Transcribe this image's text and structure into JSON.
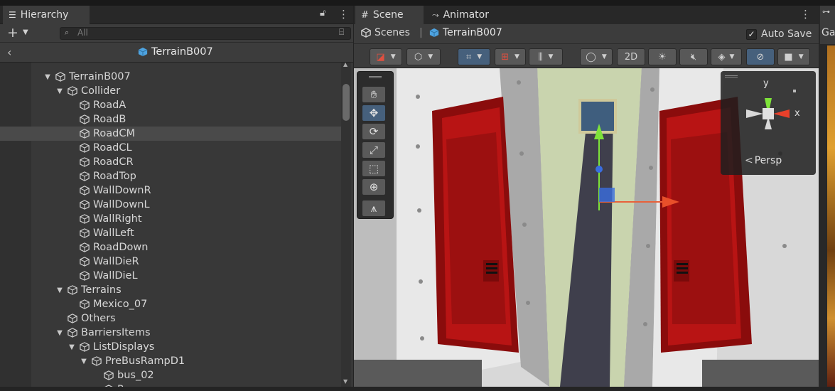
{
  "hierarchy": {
    "tab_label": "Hierarchy",
    "search_placeholder": "All",
    "breadcrumb": "TerrainB007",
    "items": [
      {
        "label": "TerrainB007",
        "depth": 0,
        "expanded": true
      },
      {
        "label": "Collider",
        "depth": 1,
        "expanded": true
      },
      {
        "label": "RoadA",
        "depth": 2
      },
      {
        "label": "RoadB",
        "depth": 2
      },
      {
        "label": "RoadCM",
        "depth": 2,
        "selected": true
      },
      {
        "label": "RoadCL",
        "depth": 2
      },
      {
        "label": "RoadCR",
        "depth": 2
      },
      {
        "label": "RoadTop",
        "depth": 2
      },
      {
        "label": "WallDownR",
        "depth": 2
      },
      {
        "label": "WallDownL",
        "depth": 2
      },
      {
        "label": "WallRight",
        "depth": 2
      },
      {
        "label": "WallLeft",
        "depth": 2
      },
      {
        "label": "RoadDown",
        "depth": 2
      },
      {
        "label": "WallDieR",
        "depth": 2
      },
      {
        "label": "WallDieL",
        "depth": 2
      },
      {
        "label": "Terrains",
        "depth": 1,
        "expanded": true
      },
      {
        "label": "Mexico_07",
        "depth": 2
      },
      {
        "label": "Others",
        "depth": 1
      },
      {
        "label": "BarriersItems",
        "depth": 1,
        "expanded": true
      },
      {
        "label": "ListDisplays",
        "depth": 2,
        "expanded": true
      },
      {
        "label": "PreBusRampD1",
        "depth": 3,
        "expanded": true
      },
      {
        "label": "bus_02",
        "depth": 4
      },
      {
        "label": "Ramp",
        "depth": 4
      }
    ]
  },
  "scene": {
    "tab_scene": "Scene",
    "tab_animator": "Animator",
    "crumb_root": "Scenes",
    "crumb_current": "TerrainB007",
    "auto_save_label": "Auto Save",
    "auto_save_checked": true,
    "btn_2d": "2D",
    "gizmo_y": "y",
    "gizmo_x": "x",
    "persp_label": "Persp"
  },
  "right_tab": "Ga"
}
